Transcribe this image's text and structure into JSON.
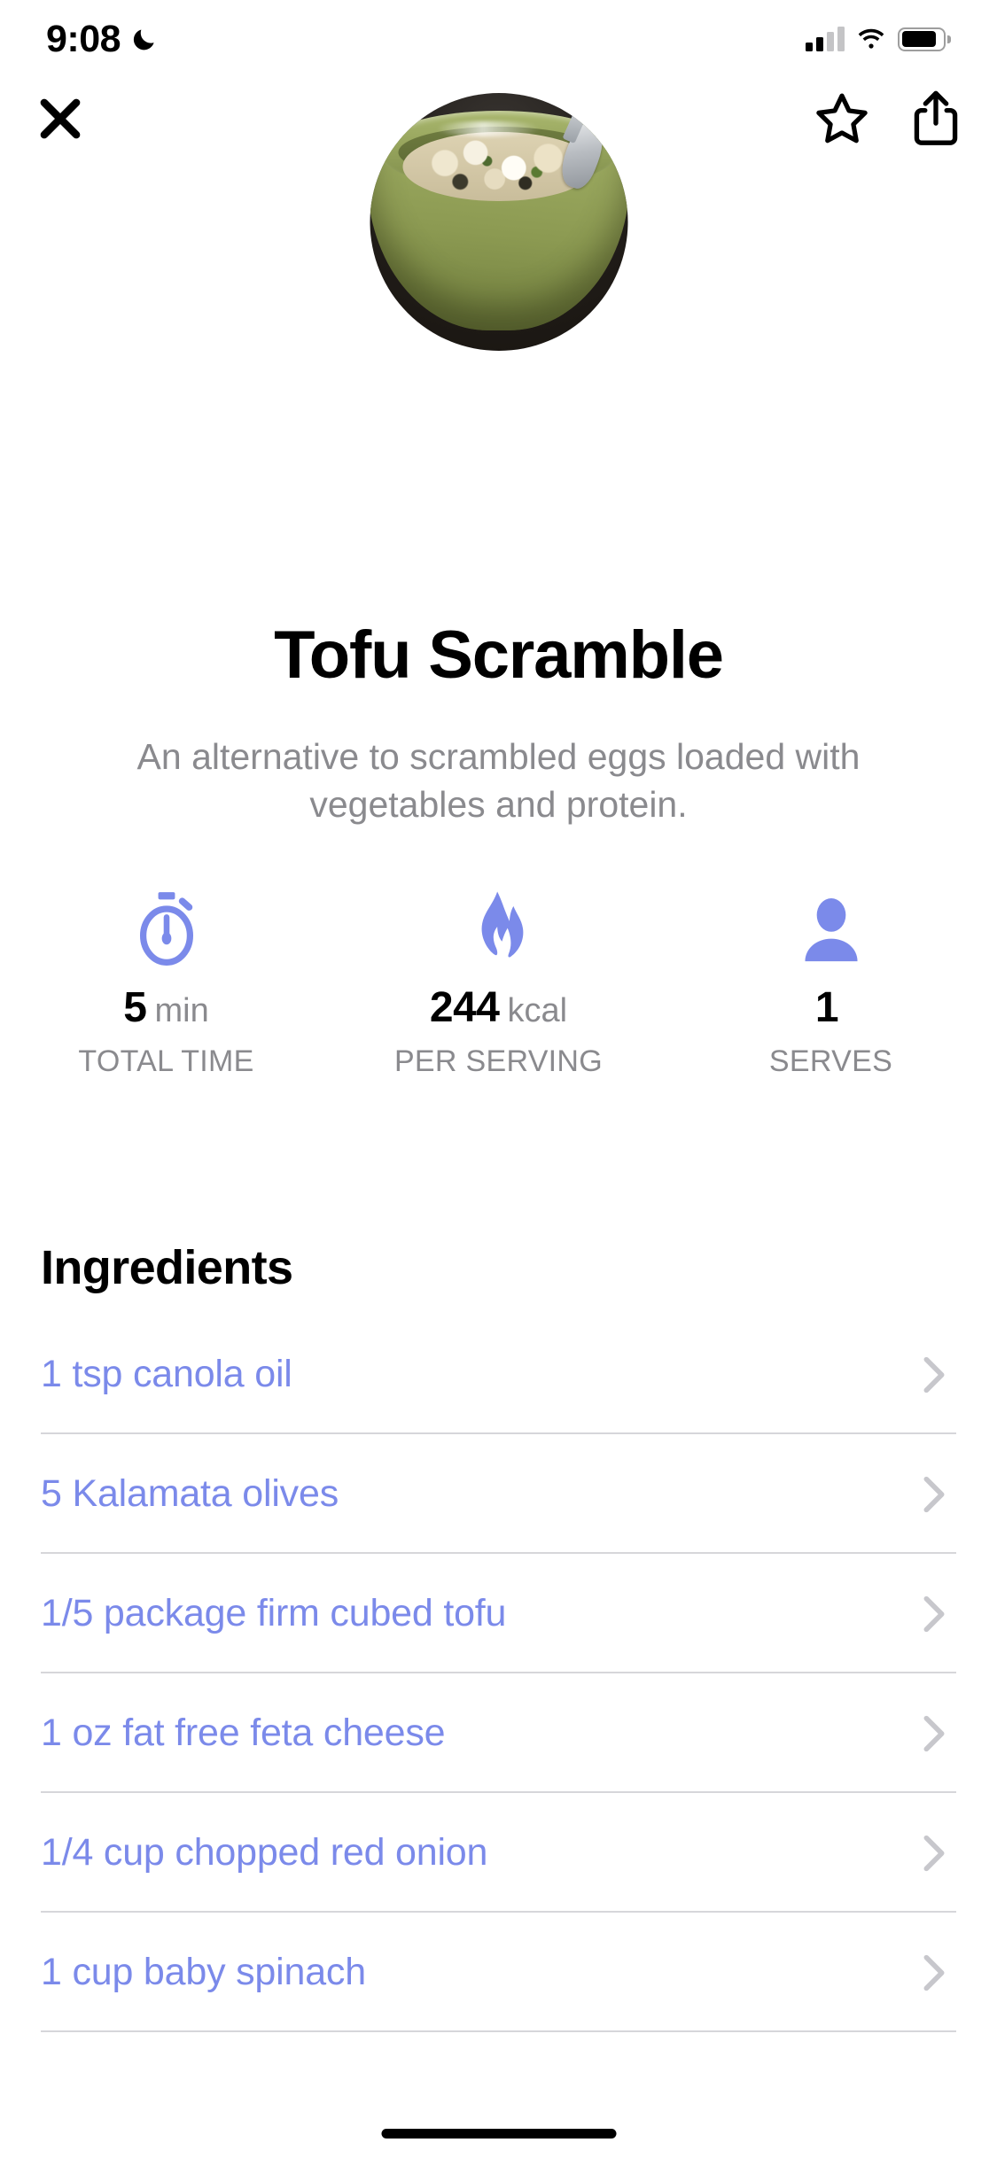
{
  "status_bar": {
    "time": "9:08",
    "dnd_icon": "crescent-moon-icon",
    "cellular_icon": "signal-bars-icon",
    "wifi_icon": "wifi-icon",
    "battery_icon": "battery-full-icon"
  },
  "toolbar": {
    "close_icon": "close-x-icon",
    "favorite_icon": "star-outline-icon",
    "share_icon": "share-ios-icon"
  },
  "hero": {
    "image_alt": "Tofu scramble in a green ceramic bowl with a spoon",
    "shape": "circle"
  },
  "recipe": {
    "title": "Tofu Scramble",
    "description": "An alternative to scrambled eggs loaded with vegetables and protein."
  },
  "stats": [
    {
      "icon": "stopwatch-icon",
      "value": "5",
      "unit": "min",
      "label": "TOTAL TIME"
    },
    {
      "icon": "flame-icon",
      "value": "244",
      "unit": "kcal",
      "label": "PER SERVING"
    },
    {
      "icon": "person-icon",
      "value": "1",
      "unit": "",
      "label": "SERVES"
    }
  ],
  "ingredients_section": {
    "heading": "Ingredients",
    "items": [
      {
        "label": "1 tsp canola oil",
        "chevron": "chevron-right-icon"
      },
      {
        "label": "5 Kalamata olives",
        "chevron": "chevron-right-icon"
      },
      {
        "label": "1/5 package firm cubed tofu",
        "chevron": "chevron-right-icon"
      },
      {
        "label": "1 oz fat free feta cheese",
        "chevron": "chevron-right-icon"
      },
      {
        "label": "1/4 cup chopped red onion",
        "chevron": "chevron-right-icon"
      },
      {
        "label": "1 cup baby spinach",
        "chevron": "chevron-right-icon"
      }
    ]
  },
  "colors": {
    "accent": "#7b8aea",
    "text_primary": "#000000",
    "text_secondary": "#8a8a8e",
    "separator": "#d6d6da",
    "chevron": "#c7c7cc",
    "background": "#ffffff"
  },
  "home_indicator": "home-indicator"
}
